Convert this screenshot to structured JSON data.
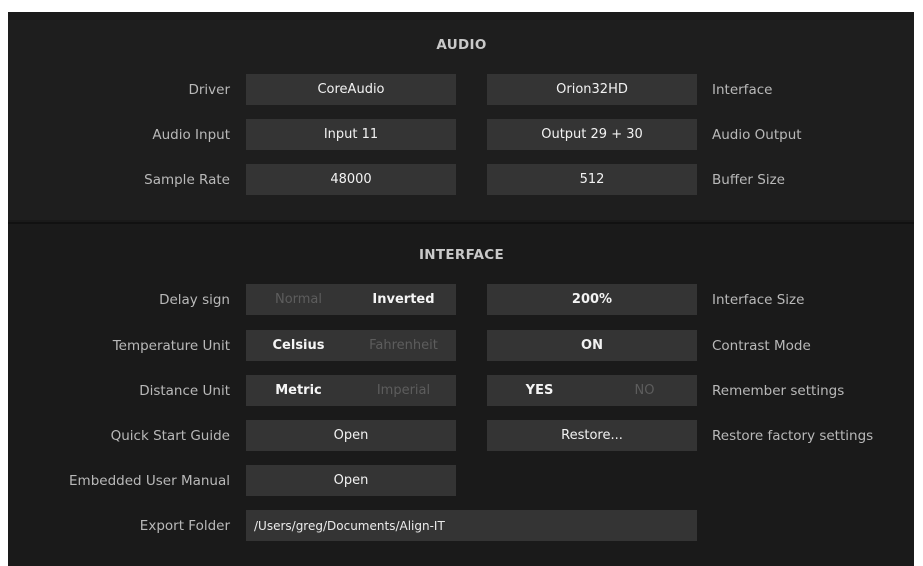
{
  "audio": {
    "title": "AUDIO",
    "driver_label": "Driver",
    "driver_value": "CoreAudio",
    "interface_label": "Interface",
    "interface_value": "Orion32HD",
    "input_label": "Audio Input",
    "input_value": "Input 11",
    "output_label": "Audio Output",
    "output_value": "Output 29 + 30",
    "sample_rate_label": "Sample Rate",
    "sample_rate_value": "48000",
    "buffer_size_label": "Buffer Size",
    "buffer_size_value": "512"
  },
  "interface": {
    "title": "INTERFACE",
    "delay_sign_label": "Delay sign",
    "delay_sign_options": [
      "Normal",
      "Inverted"
    ],
    "delay_sign_selected": "Inverted",
    "interface_size_label": "Interface Size",
    "interface_size_value": "200%",
    "temperature_label": "Temperature Unit",
    "temperature_options": [
      "Celsius",
      "Fahrenheit"
    ],
    "temperature_selected": "Celsius",
    "contrast_label": "Contrast Mode",
    "contrast_value": "ON",
    "distance_label": "Distance Unit",
    "distance_options": [
      "Metric",
      "Imperial"
    ],
    "distance_selected": "Metric",
    "remember_label": "Remember settings",
    "remember_options": [
      "YES",
      "NO"
    ],
    "remember_selected": "YES",
    "quick_start_label": "Quick Start Guide",
    "quick_start_button": "Open",
    "restore_label": "Restore factory settings",
    "restore_button": "Restore...",
    "manual_label": "Embedded User Manual",
    "manual_button": "Open",
    "export_label": "Export Folder",
    "export_path": "/Users/greg/Documents/Align-IT"
  },
  "colors": {
    "background": "#1a1a1a",
    "control": "#343434",
    "label": "#b9b9b9",
    "active_text": "#f5f5f5",
    "inactive_text": "#5d5d5d"
  }
}
